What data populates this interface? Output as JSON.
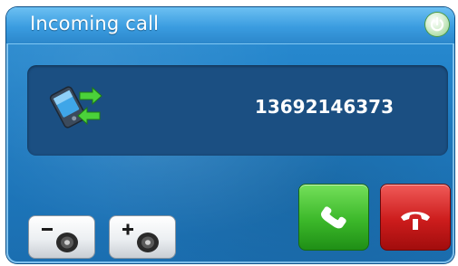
{
  "window": {
    "title": "Incoming call"
  },
  "call": {
    "caller_number": "13692146373"
  },
  "icons": {
    "power": "power-icon",
    "phone": "phone-transfer-icon",
    "volume_down": "volume-down-icon",
    "volume_up": "volume-up-icon",
    "answer": "answer-call-icon",
    "reject": "end-call-icon"
  },
  "colors": {
    "window_background": "#1f7cc2",
    "panel_background": "#1b4f82",
    "answer_green": "#3cb82a",
    "reject_red": "#cc1c1c"
  }
}
